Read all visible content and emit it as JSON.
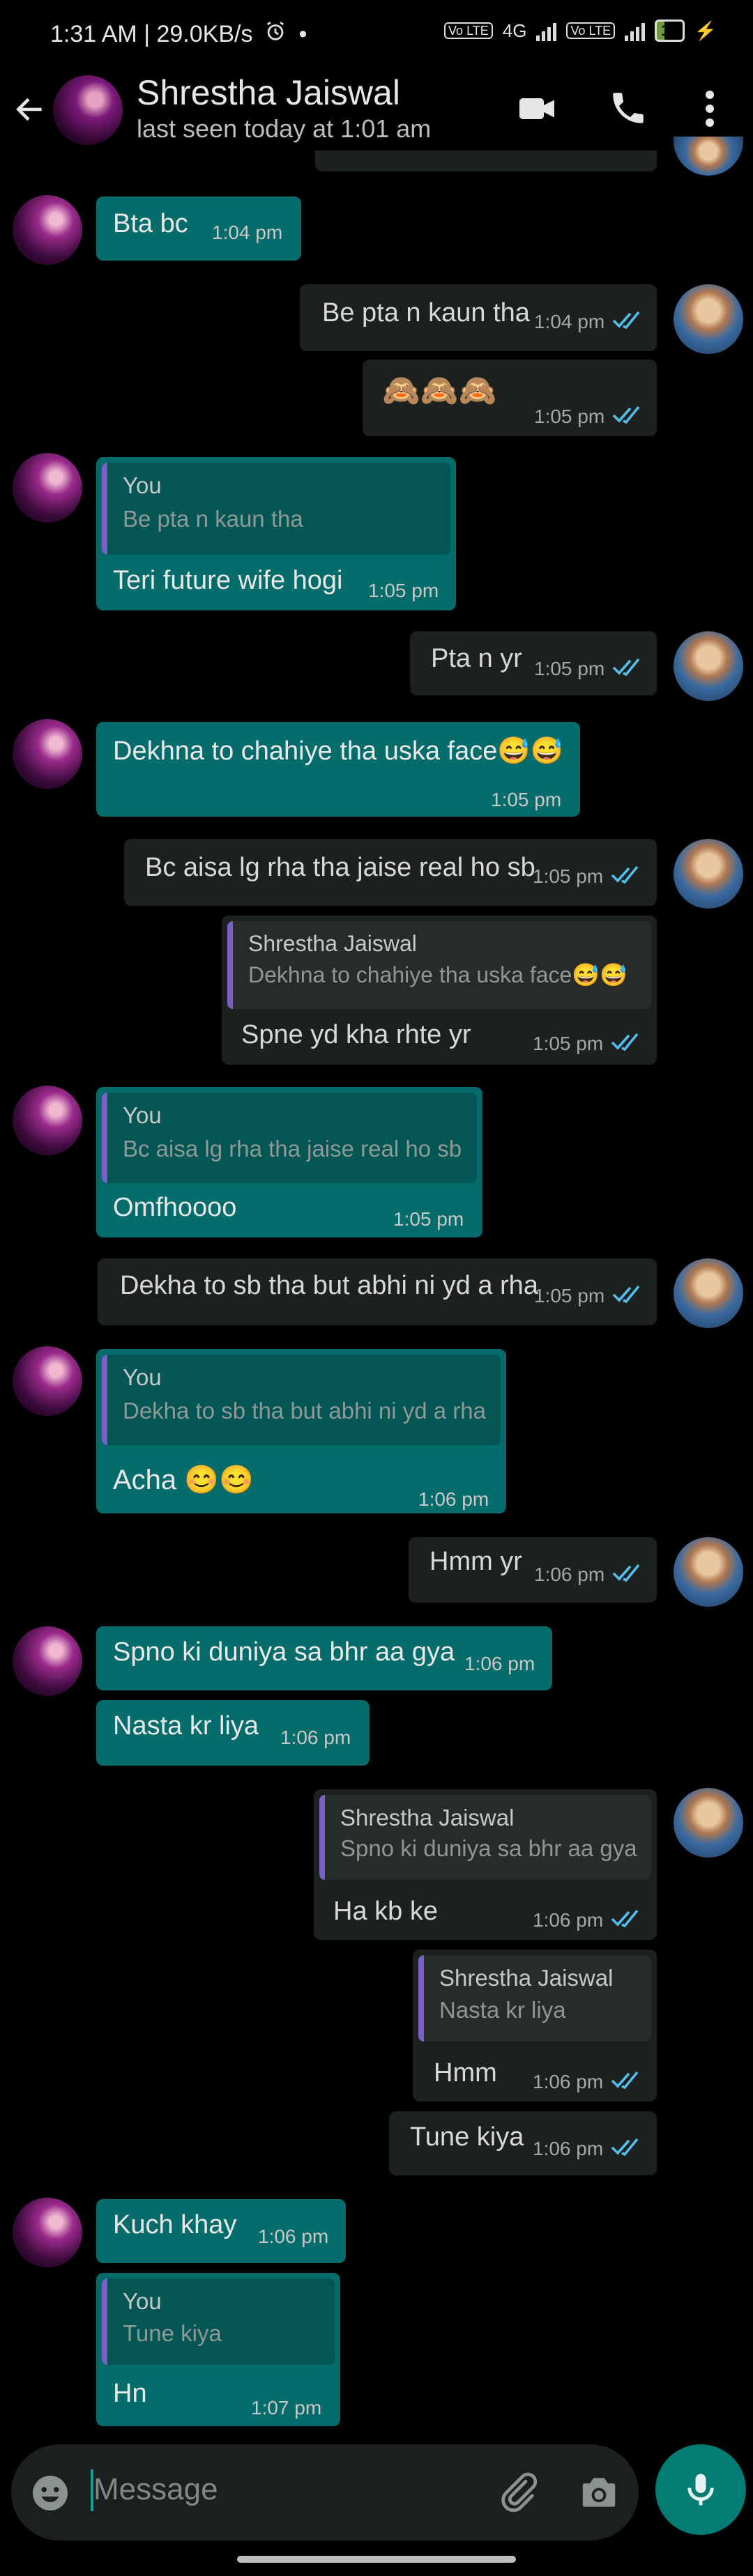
{
  "status_bar": {
    "time_speed": "1:31 AM | 29.0KB/s",
    "network_1": "Vo LTE",
    "network_type": "4G",
    "network_2": "Vo LTE",
    "battery": "17"
  },
  "header": {
    "contact_name": "Shrestha Jaiswal",
    "last_seen": "last seen today at 1:01 am"
  },
  "messages": [
    {
      "text": "Bta bc",
      "time": "1:04 pm"
    },
    {
      "text": "Be pta n kaun tha",
      "time": "1:04 pm"
    },
    {
      "text": "🙈🙈🙈",
      "time": "1:05 pm"
    },
    {
      "quote_name": "You",
      "quote_text": "Be pta n kaun tha",
      "text": "Teri future wife hogi",
      "time": "1:05 pm"
    },
    {
      "text": "Pta n yr",
      "time": "1:05 pm"
    },
    {
      "text": "Dekhna to chahiye tha uska face😅😅",
      "time": "1:05 pm"
    },
    {
      "text": "Bc aisa lg rha tha jaise real ho sb",
      "time": "1:05 pm"
    },
    {
      "quote_name": "Shrestha Jaiswal",
      "quote_text": "Dekhna to chahiye tha uska face😅😅",
      "text": "Spne yd kha rhte yr",
      "time": "1:05 pm"
    },
    {
      "quote_name": "You",
      "quote_text": "Bc aisa lg rha tha jaise real ho sb",
      "text": "Omfhoooo",
      "time": "1:05 pm"
    },
    {
      "text": "Dekha to sb tha but abhi ni yd a rha",
      "time": "1:05 pm"
    },
    {
      "quote_name": "You",
      "quote_text": "Dekha to sb tha but abhi ni yd a rha",
      "text": "Acha 😊😊",
      "time": "1:06 pm"
    },
    {
      "text": "Hmm yr",
      "time": "1:06 pm"
    },
    {
      "text": "Spno ki duniya sa bhr aa gya",
      "time": "1:06 pm"
    },
    {
      "text": "Nasta kr liya",
      "time": "1:06 pm"
    },
    {
      "quote_name": "Shrestha Jaiswal",
      "quote_text": "Spno ki duniya sa bhr aa gya",
      "text": "Ha kb ke",
      "time": "1:06 pm"
    },
    {
      "quote_name": "Shrestha Jaiswal",
      "quote_text": "Nasta kr liya",
      "text": "Hmm",
      "time": "1:06 pm"
    },
    {
      "text": "Tune kiya",
      "time": "1:06 pm"
    },
    {
      "text": "Kuch khay",
      "time": "1:06 pm"
    },
    {
      "quote_name": "You",
      "quote_text": "Tune kiya",
      "text": "Hn",
      "time": "1:07 pm"
    }
  ],
  "composer": {
    "placeholder": "Message"
  },
  "colors": {
    "incoming_bubble": "#046c6a",
    "outgoing_bubble": "#1c211f",
    "read_tick": "#53bdeb",
    "quote_bar": "#7a5fc8",
    "mic_button": "#037c74"
  }
}
